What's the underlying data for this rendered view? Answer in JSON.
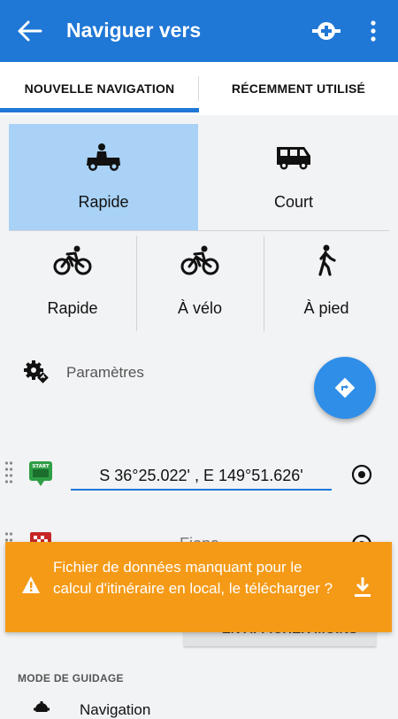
{
  "app_bar": {
    "title": "Naviguer vers",
    "back_icon": "arrow-left-icon",
    "add_waypoint_icon": "add-waypoint-icon",
    "menu_icon": "more-vertical-icon",
    "color": "#1f77d6"
  },
  "tabs": [
    {
      "label": "NOUVELLE NAVIGATION",
      "selected": true
    },
    {
      "label": "RÉCEMMENT UTILISÉ",
      "selected": false
    }
  ],
  "route_modes": {
    "car_fast": {
      "label": "Rapide",
      "icon": "car-icon",
      "selected": true
    },
    "car_short": {
      "label": "Court",
      "icon": "van-icon",
      "selected": false
    },
    "bike_fast": {
      "label": "Rapide",
      "icon": "bicycle-icon",
      "selected": false
    },
    "bike": {
      "label": "À vélo",
      "icon": "bicycle-icon",
      "selected": false
    },
    "foot": {
      "label": "À pied",
      "icon": "pedestrian-icon",
      "selected": false
    }
  },
  "settings": {
    "label": "Paramètres",
    "icon": "gear-icon"
  },
  "fab": {
    "icon": "navigate-icon",
    "color": "#2f8ee8"
  },
  "waypoints": {
    "start": {
      "value": "S 36°25.022' , E 149°51.626'",
      "icon_text": "START"
    },
    "finish": {
      "label": "Fiona"
    }
  },
  "show_less": {
    "label": "EN AFFICHER MOINS",
    "icon": "chevron-up-icon"
  },
  "guidance": {
    "title": "MODE DE GUIDAGE",
    "item": "Navigation",
    "icon": "gear-icon"
  },
  "banner": {
    "message": "Fichier de données manquant pour le calcul d'itinéraire en local, le télécharger ?",
    "warning_icon": "warning-icon",
    "download_icon": "download-icon",
    "color": "#f59a16"
  }
}
